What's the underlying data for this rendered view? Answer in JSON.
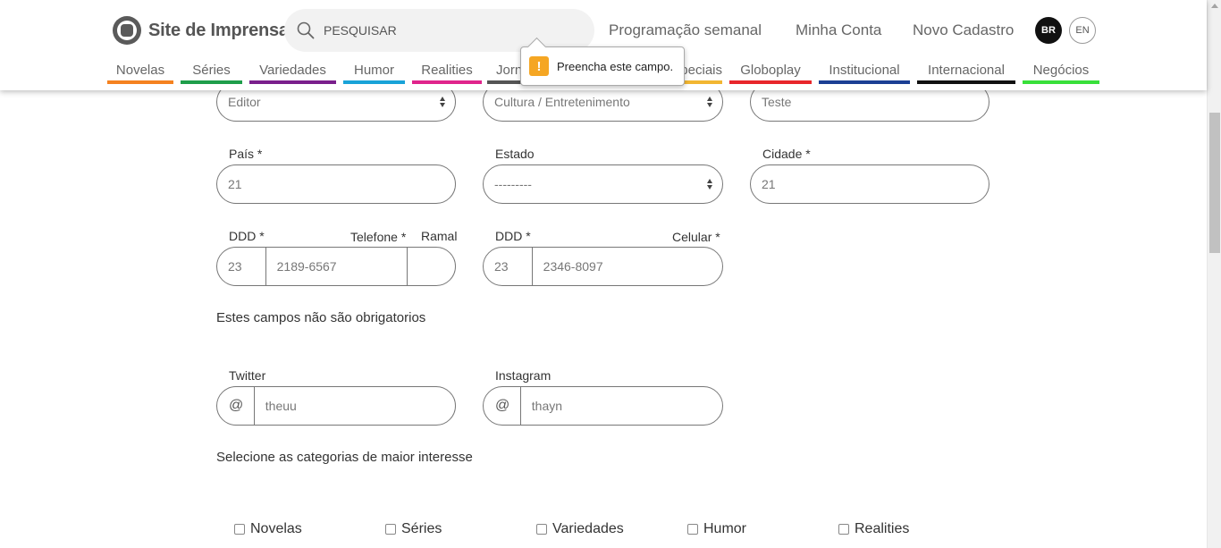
{
  "header": {
    "logo_text": "Site de Imprensa",
    "search_placeholder": "PESQUISAR",
    "links": [
      "Programação semanal",
      "Minha Conta",
      "Novo Cadastro"
    ],
    "lang_br": "BR",
    "lang_en": "EN"
  },
  "categories_nav": [
    {
      "label": "Novelas",
      "color": "#f58220"
    },
    {
      "label": "Séries",
      "color": "#1e9e4a"
    },
    {
      "label": "Variedades",
      "color": "#7a1f8c"
    },
    {
      "label": "Humor",
      "color": "#19a3d8"
    },
    {
      "label": "Realities",
      "color": "#e0248c"
    },
    {
      "label": "Jornalismo",
      "color": "#555555"
    },
    {
      "label": "Especiais",
      "color": "#f2b632"
    },
    {
      "label": "Globoplay",
      "color": "#e8262b"
    },
    {
      "label": "Institucional",
      "color": "#1b3f94"
    },
    {
      "label": "Internacional",
      "color": "#111111"
    },
    {
      "label": "Negócios",
      "color": "#38e03a"
    }
  ],
  "tooltip": {
    "icon": "!",
    "text": "Preencha este campo."
  },
  "form": {
    "cargo_value": "Editor",
    "area_value": "Cultura / Entretenimento",
    "empresa_value": "Teste",
    "pais_label": "País *",
    "pais_value": "21",
    "estado_label": "Estado",
    "estado_value": "---------",
    "cidade_label": "Cidade *",
    "cidade_value": "21",
    "ddd_label": "DDD *",
    "telefone_label": "Telefone *",
    "ramal_label": "Ramal",
    "phone_ddd": "23",
    "phone_number": "2189-6567",
    "phone_ramal": "",
    "ddd2_label": "DDD *",
    "celular_label": "Celular *",
    "cell_ddd": "23",
    "cell_number": "2346-8097",
    "optional_title": "Estes campos não são obrigatorios",
    "twitter_label": "Twitter",
    "twitter_prefix": "@",
    "twitter_value": "theuu",
    "instagram_label": "Instagram",
    "instagram_prefix": "@",
    "instagram_value": "thayn",
    "interests_title": "Selecione as categorias de maior interesse",
    "interests": [
      "Novelas",
      "Séries",
      "Variedades",
      "Humor",
      "Realities"
    ]
  }
}
